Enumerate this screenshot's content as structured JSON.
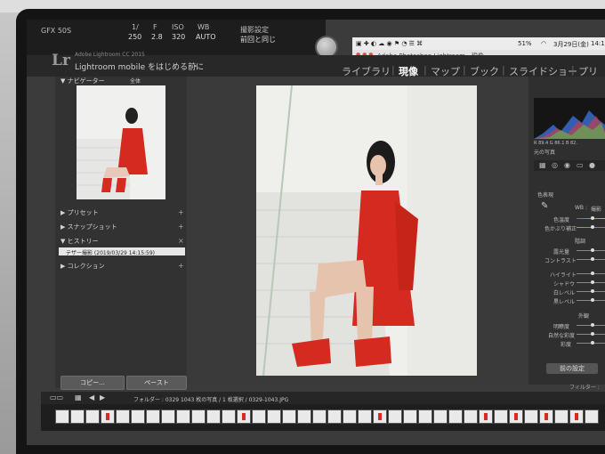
{
  "camera": {
    "model": "GFX 50S",
    "shutter_label": "1/",
    "shutter_value": "250",
    "aperture_label": "F",
    "aperture_value": "2.8",
    "iso_label": "ISO",
    "iso_value": "320",
    "wb_label": "WB",
    "wb_value": "AUTO",
    "setting_label": "撮影設定",
    "setting_value": "前回と同じ"
  },
  "menubar": {
    "battery": "51%",
    "date": "3月29日(金)",
    "time": "14:16"
  },
  "ps_window_title": "Adobe Photoshop Lightroom - 現像",
  "lightroom": {
    "logo": "Lr",
    "product": "Adobe Lightroom CC 2015",
    "mobile_prompt": "Lightroom mobile をはじめる前に",
    "modules": [
      "ライブラリ",
      "現像",
      "マップ",
      "ブック",
      "スライドショー",
      "プリン"
    ],
    "active_module": "現像"
  },
  "left_panel": {
    "navigator": "ナビゲーター",
    "navigator_zoom": "全体",
    "presets": "プリセット",
    "snapshots": "スナップショット",
    "history": "ヒストリー",
    "history_item": "テザー撮影 (2019/03/29 14:15:59)",
    "collections": "コレクション",
    "copy_button": "コピー...",
    "paste_button": "ペースト"
  },
  "right_panel": {
    "basic": "色表現",
    "wb": "WB :",
    "wb_value": "撮影",
    "temp": "色温度",
    "tint": "色かぶり補正",
    "tone": "階調",
    "exposure": "露光量",
    "contrast": "コントラスト",
    "highlights": "ハイライト",
    "shadows": "シャドウ",
    "whites": "白レベル",
    "blacks": "黒レベル",
    "presence": "外観",
    "clarity": "明瞭度",
    "vibrance": "自然な彩度",
    "saturation": "彩度",
    "histogram_readout": "R 89.4  G 86.1  B 82.",
    "original_label": "元の写真",
    "previous_button": "前の設定"
  },
  "filmstrip": {
    "info": "フォルダー : 0329  1043 枚の写真 / 1 枚選択 / 0329-1043.JPG",
    "filter_label": "フィルター :"
  },
  "colors": {
    "dress_red": "#d52a1f",
    "panel_dark": "#323232",
    "active_white": "#ffffff"
  }
}
